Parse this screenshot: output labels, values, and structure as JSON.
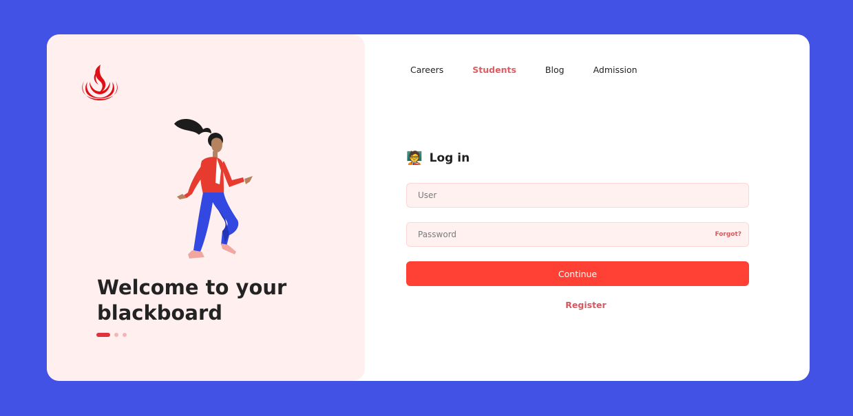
{
  "brand": {
    "logo_icon": "flame-logo-icon",
    "accent": "#e0323d"
  },
  "hero": {
    "title": "Welcome to your blackboard",
    "illustration": "running-woman-illustration",
    "carousel": {
      "count": 3,
      "active_index": 0
    }
  },
  "nav": {
    "items": [
      {
        "label": "Careers",
        "active": false
      },
      {
        "label": "Students",
        "active": true
      },
      {
        "label": "Blog",
        "active": false
      },
      {
        "label": "Admission",
        "active": false
      }
    ]
  },
  "login": {
    "emoji": "🧑‍🏫",
    "title": "Log in",
    "user_placeholder": "User",
    "password_placeholder": "Password",
    "forgot_label": "Forgot?",
    "continue_label": "Continue",
    "register_label": "Register"
  },
  "colors": {
    "page_background": "#4152e4",
    "panel_background": "#fff0ef",
    "button": "#ff4034",
    "link": "#d45a61"
  }
}
